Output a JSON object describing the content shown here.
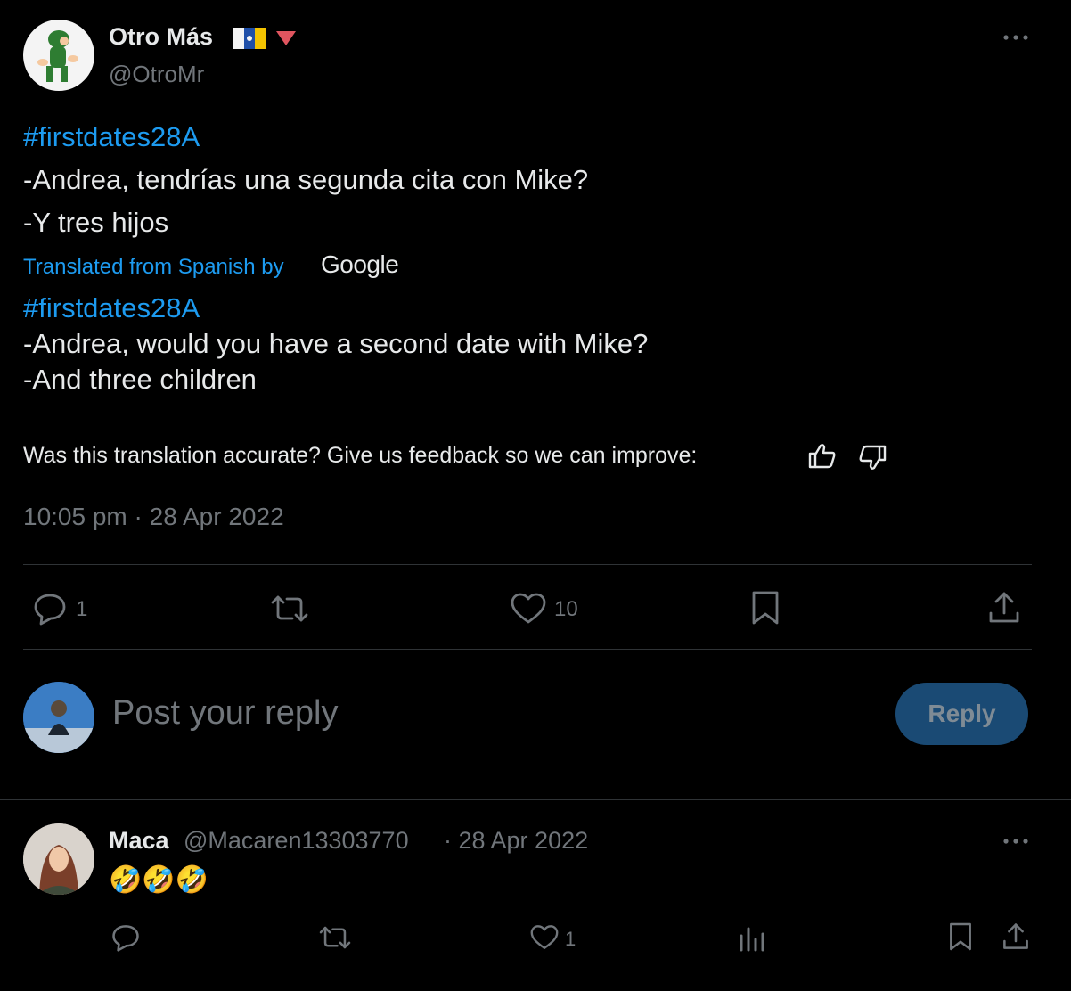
{
  "post": {
    "author_name": "Otro Más",
    "author_handle": "@OtroMr",
    "hashtag": "#firstdates28A",
    "line1": "-Andrea, tendrías una segunda cita con Mike?",
    "line2": "-Y tres hijos",
    "translated_label": "Translated from Spanish by",
    "translator": "Google",
    "translated_hashtag": "#firstdates28A",
    "translated_line1": "-Andrea, would you have a second date with Mike?",
    "translated_line2": "-And three children",
    "feedback_prompt": "Was this translation accurate? Give us feedback so we can improve:",
    "timestamp": "10:05 pm · 28 Apr 2022",
    "reply_count": "1",
    "like_count": "10"
  },
  "composer": {
    "placeholder": "Post your reply",
    "reply_button": "Reply"
  },
  "reply": {
    "author_name": "Maca",
    "author_handle": "@Macaren13303770",
    "date": "· 28 Apr 2022",
    "content": "🤣🤣🤣",
    "like_count": "1"
  },
  "colors": {
    "accent": "#1d9bf0",
    "muted": "#71767b",
    "divider": "#2f3336",
    "reply_button_bg": "#1a4a74"
  }
}
